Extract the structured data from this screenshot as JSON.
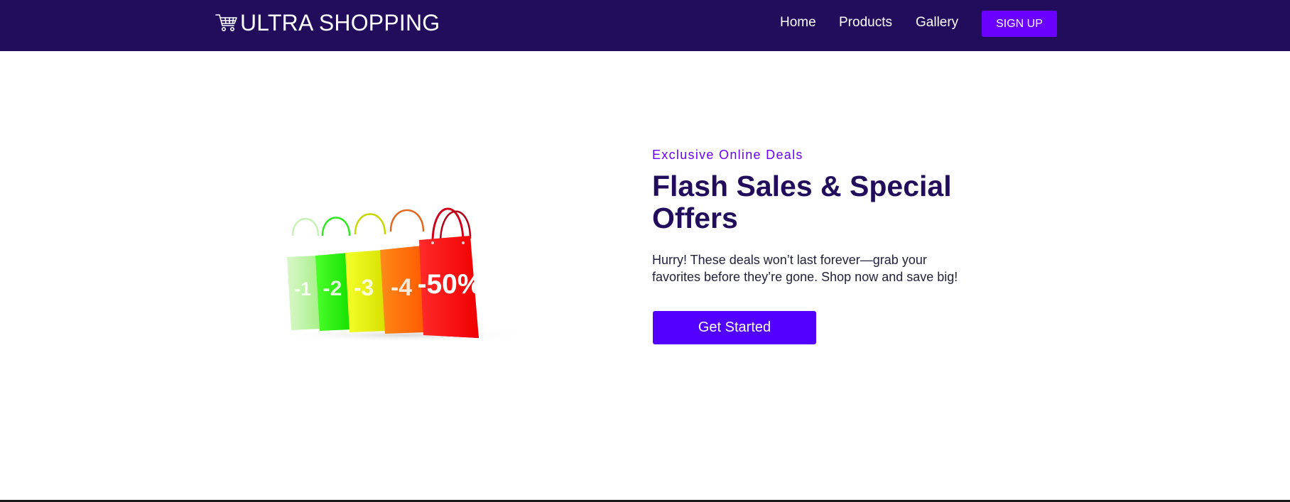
{
  "header": {
    "brand": "ULTRA SHOPPING",
    "brand_icon": "shopping-cart-icon",
    "nav": {
      "home": "Home",
      "products": "Products",
      "gallery": "Gallery"
    },
    "signup_label": "SIGN UP"
  },
  "hero": {
    "image": {
      "description": "discount shopping bags",
      "bag_labels": [
        "-1",
        "-2",
        "-3",
        "-4",
        "-50%"
      ]
    },
    "eyebrow": "Exclusive Online Deals",
    "title": "Flash Sales & Special Offers",
    "description": "Hurry! These deals won’t last forever—grab your favorites before they’re gone. Shop now and save big!",
    "cta_label": "Get Started"
  },
  "colors": {
    "navbar_bg": "#210d5c",
    "accent": "#6a00ff",
    "cta_bg": "#5200ff",
    "title": "#210d5c"
  }
}
